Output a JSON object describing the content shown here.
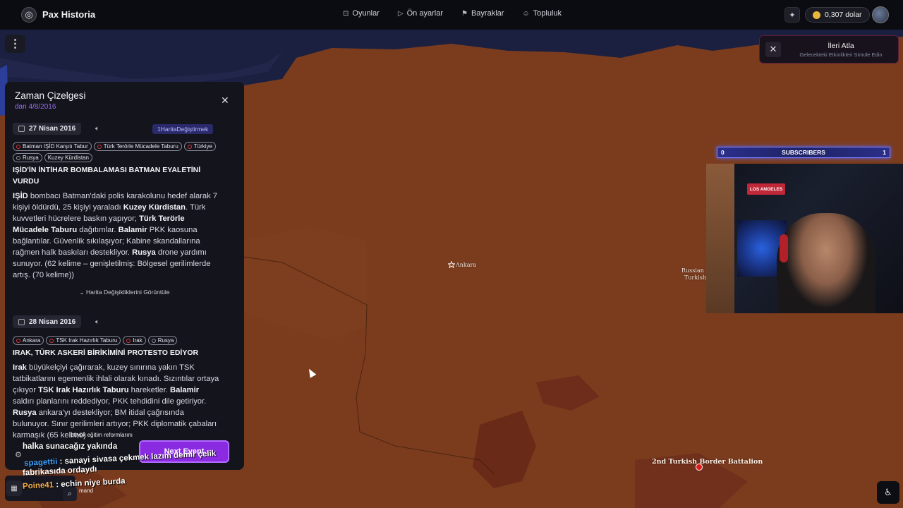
{
  "app": {
    "brand": "Pax Historia"
  },
  "nav": [
    {
      "icon": "gamepad-icon",
      "label": "Oyunlar"
    },
    {
      "icon": "play-icon",
      "label": "Ön ayarlar"
    },
    {
      "icon": "flag-icon",
      "label": "Bayraklar"
    },
    {
      "icon": "users-icon",
      "label": "Topluluk"
    }
  ],
  "wallet": {
    "amount": "0,307 dolar"
  },
  "skip_ahead": {
    "title": "İleri Atla",
    "subtitle": "Gelecekteki Etkinlikleri Simüle Edin"
  },
  "subscribers": {
    "label": "SUBSCRIBERS",
    "current": "0",
    "goal": "1"
  },
  "map": {
    "city": "Ankara",
    "region_label_line1": "Russian -",
    "region_label_line2": "Turkish",
    "unit": "2nd Turkish Border Battalion"
  },
  "timeline": {
    "title": "Zaman Çizelgesi",
    "subtitle": "dan 4/8/2016",
    "entries": [
      {
        "date": "27 Nisan 2016",
        "map_change": "1HaritaDeğiştirmek",
        "tags": [
          {
            "label": "Batman IŞİD Karşıtı Tabur",
            "dot": "red"
          },
          {
            "label": "Türk Terörle Mücadele Taburu",
            "dot": "red"
          },
          {
            "label": "Türkiye",
            "dot": "red"
          },
          {
            "label": "Rusya",
            "dot": "grey"
          },
          {
            "label": "Kuzey Kürdistan",
            "dot": "none"
          }
        ],
        "title": "IŞİD'İN İNTİHAR BOMBALAMASI BATMAN EYALETİNİ VURDU",
        "body": [
          {
            "b": "IŞİD"
          },
          {
            "t": " bombacı Batman'daki polis karakolunu hedef alarak 7 kişiyi öldürdü, 25 kişiyi yaraladı "
          },
          {
            "b": "Kuzey Kürdistan"
          },
          {
            "t": ". Türk kuvvetleri hücrelere baskın yapıyor; "
          },
          {
            "b": "Türk Terörle Mücadele Taburu"
          },
          {
            "t": " dağıtımlar. "
          },
          {
            "b": "Balamir"
          },
          {
            "t": " PKK kaosuna bağlantılar. Güvenlik sıkılaşıyor; Kabine skandallarına rağmen halk baskıları destekliyor. "
          },
          {
            "b": "Rusya"
          },
          {
            "t": " drone yardımı sunuyor. (62 kelime – genişletilmiş: Bölgesel gerilimlerde artış. (70 kelime))"
          }
        ],
        "show_changes": "Harita Değişikliklerini Görüntüle"
      },
      {
        "date": "28 Nisan 2016",
        "tags": [
          {
            "label": "Ankara",
            "dot": "red"
          },
          {
            "label": "TSK Irak Hazırlık Taburu",
            "dot": "red"
          },
          {
            "label": "Irak",
            "dot": "red"
          },
          {
            "label": "Rusya",
            "dot": "grey"
          }
        ],
        "title": "IRAK, TÜRK ASKERİ BİRİKİMİNİ PROTESTO EDİYOR",
        "body": [
          {
            "b": "Irak"
          },
          {
            "t": " büyükelçiyi çağırarak, kuzey sınırına yakın TSK tatbikatlarını egemenlik ihlali olarak kınadı. Sızıntılar ortaya çıkıyor "
          },
          {
            "b": "TSK Irak Hazırlık Taburu"
          },
          {
            "t": " hareketler. "
          },
          {
            "b": "Balamir"
          },
          {
            "t": " saldırı planlarını reddediyor, PKK tehdidini dile getiriyor. "
          },
          {
            "b": "Rusya"
          },
          {
            "t": " ankara'yı destekliyor; BM itidal çağrısında bulunuyor. Sınır gerilimleri artıyor; PKK diplomatik çabaları karmaşık (65 kelime)"
          }
        ]
      }
    ],
    "next_event": "Next Event"
  },
  "chat": [
    {
      "user": "spagettii",
      "message": "sanayi sivasa çekmek lazım demir çelik"
    },
    {
      "user": "",
      "message": "fabrikasıda ordaydı"
    },
    {
      "user": "Poine41",
      "message": "echin niye burda"
    }
  ],
  "chat_faint": [
    "büyük eğitim reformlarını ",
    "halka sunacağız yakında",
    "mand"
  ]
}
